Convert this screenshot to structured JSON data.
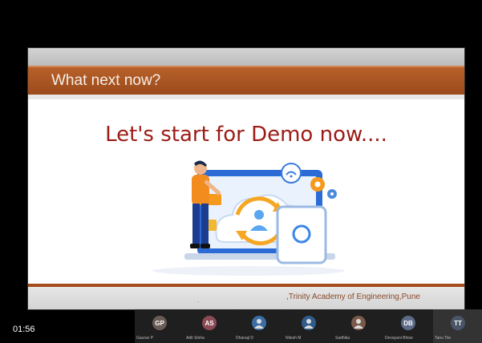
{
  "slide": {
    "title": "What next now?",
    "headline": "Let's start for Demo now....",
    "footer_dot": ".",
    "footer_text": ",Trinity Academy of Engineering,Pune"
  },
  "call": {
    "timer": "01:56",
    "participants": [
      {
        "initials": "GP",
        "color": "#6b5b55",
        "kind": "initials",
        "name": "Gaurav P"
      },
      {
        "initials": "AS",
        "color": "#8a4a55",
        "kind": "initials",
        "name": "Adit Sinha"
      },
      {
        "initials": "",
        "color": "#3a6ea5",
        "kind": "photo",
        "name": "Dhanaji D"
      },
      {
        "initials": "",
        "color": "#2f5c8a",
        "kind": "photo",
        "name": "Nilesh M"
      },
      {
        "initials": "",
        "color": "#7a5a4a",
        "kind": "photo",
        "name": "Sadhika"
      },
      {
        "initials": "DB",
        "color": "#5c6b88",
        "kind": "initials",
        "name": "Devayani Bhise"
      },
      {
        "initials": "TT",
        "color": "#4a5568",
        "kind": "initials",
        "name": "Tanu Tiw"
      }
    ]
  }
}
